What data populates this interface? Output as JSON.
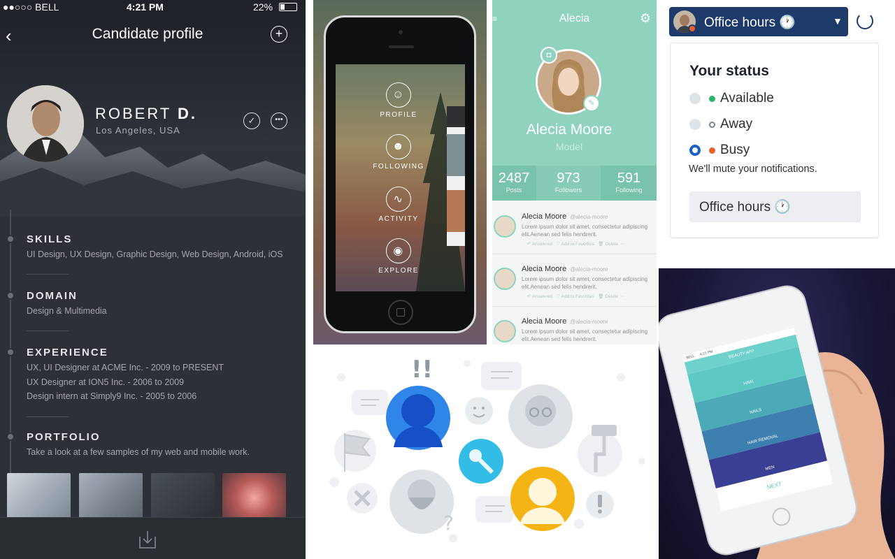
{
  "profile": {
    "status_carrier": "●●○○○ BELL",
    "status_time": "4:21 PM",
    "status_battery": "22%",
    "title": "Candidate profile",
    "first_name": "ROBERT",
    "last_initial": "D.",
    "location": "Los Angeles, USA",
    "sections": [
      {
        "title": "SKILLS",
        "lines": [
          "UI Design, UX Design, Graphic Design, Web Design, Android, iOS"
        ]
      },
      {
        "title": "DOMAIN",
        "lines": [
          "Design & Multimedia"
        ]
      },
      {
        "title": "EXPERIENCE",
        "lines": [
          "UX, UI Designer at ACME Inc. - 2009 to PRESENT",
          "UX Designer at ION5 Inc. - 2006 to 2009",
          "Design intern at Simply9 Inc. - 2005 to 2006"
        ]
      },
      {
        "title": "PORTFOLIO",
        "lines": [
          "Take a look at a few samples of my web and mobile work."
        ]
      }
    ]
  },
  "phone_menu": {
    "items": [
      "PROFILE",
      "FOLLOWING",
      "ACTIVITY",
      "EXPLORE"
    ]
  },
  "alecia": {
    "header": "Alecia",
    "name": "Alecia Moore",
    "role": "Model",
    "stats": [
      {
        "n": "2487",
        "l": "Posts"
      },
      {
        "n": "973",
        "l": "Followers"
      },
      {
        "n": "591",
        "l": "Following"
      }
    ],
    "post_name": "Alecia Moore",
    "post_handle": "@alecia-moore",
    "post_text": "Lorem ipsum dolor sit amet, consectetur adipiscing elit.Aenean sed felis hendrerit.",
    "post_actions": [
      "Answered",
      "Add to Favorites",
      "Delete"
    ]
  },
  "status_menu": {
    "button_label": "Office hours",
    "title": "Your status",
    "options": [
      "Available",
      "Away",
      "Busy"
    ],
    "selected": "Busy",
    "note": "We'll mute your notifications.",
    "office_hours": "Office hours",
    "colors": {
      "available": "#2bb56a",
      "away": "#7c8592",
      "busy": "#e8612c",
      "accent": "#1d5fc9"
    }
  },
  "beauty_app": {
    "status_time": "4:21 PM",
    "status_carrier": "BELL",
    "title": "BEAUTY APP",
    "rows": [
      "HAIR",
      "NAILS",
      "HAIR REMOVAL",
      "MEN"
    ],
    "next": "NEXT"
  }
}
